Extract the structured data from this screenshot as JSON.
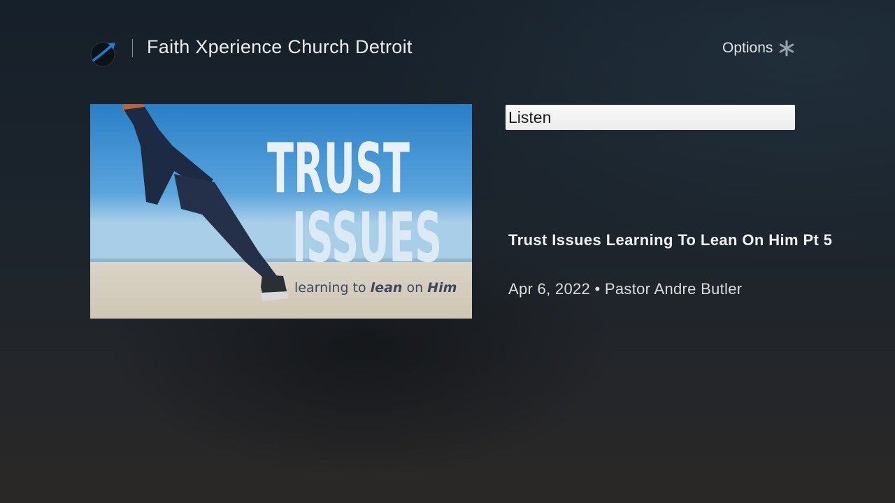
{
  "header": {
    "channel_title": "Faith Xperience Church Detroit",
    "options_label": "Options",
    "options_icon": "asterisk-icon",
    "logo_icon": "church-logo-icon"
  },
  "poster": {
    "title_line1": "TRUST",
    "title_line2": "ISSUES",
    "tagline_pre": "learning to ",
    "tagline_lean": "lean",
    "tagline_mid": " on ",
    "tagline_him": "Him"
  },
  "actions": {
    "listen_label": "Listen"
  },
  "episode": {
    "title": "Trust Issues Learning To Lean On Him Pt 5",
    "date": "Apr 6, 2022",
    "separator": "•",
    "speaker": "Pastor Andre Butler"
  },
  "colors": {
    "accent_blue": "#1a7fd0",
    "button_bg": "#f2f2f2",
    "background_top": "#16202a",
    "background_bottom": "#2a2826"
  }
}
